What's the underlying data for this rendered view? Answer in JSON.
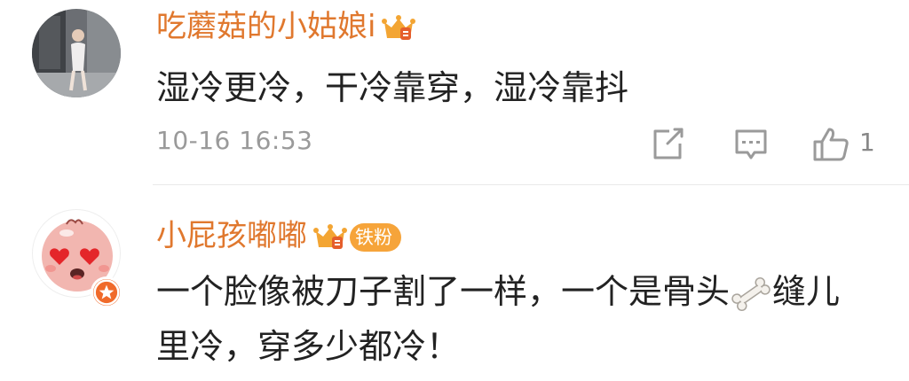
{
  "comments": [
    {
      "username": "吃蘑菇的小姑娘i",
      "text": "湿冷更冷，干冷靠穿，湿冷靠抖",
      "timestamp": "10-16 16:53",
      "like_count": "1",
      "avatar_icon": "photo-avatar",
      "badge_icon": "crown-icon"
    },
    {
      "username": "小屁孩嘟嘟",
      "badge_text": "铁粉",
      "text_before_emoji": "一个脸像被刀子割了一样，一个是骨头",
      "emoji": "bone-icon",
      "text_after_emoji": "缝儿里冷，穿多少都冷！",
      "avatar_icon": "heart-eyes-baby-avatar",
      "badge_icon": "crown-icon"
    }
  ],
  "colors": {
    "username": "#e0782e",
    "text": "#222222",
    "meta": "#9a9a9a",
    "badge": "#f6a43a",
    "divider": "#e9e9e9"
  }
}
